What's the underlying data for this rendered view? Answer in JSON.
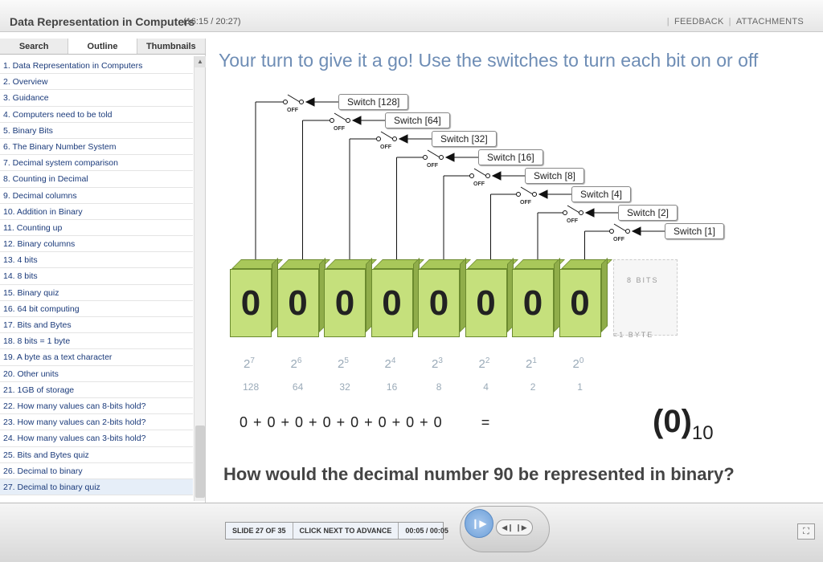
{
  "header": {
    "title": "Data Representation in Computers",
    "time": "(16:15 / 20:27)",
    "feedback": "FEEDBACK",
    "attachments": "ATTACHMENTS"
  },
  "sidebar": {
    "tabs": [
      "Search",
      "Outline",
      "Thumbnails"
    ],
    "items": [
      "1. Data Representation in Computers",
      "2. Overview",
      "3. Guidance",
      "4. Computers need to be told",
      "5. Binary Bits",
      "6. The Binary Number System",
      "7. Decimal system comparison",
      "8. Counting in Decimal",
      "9. Decimal columns",
      "10. Addition in Binary",
      "11. Counting up",
      "12. Binary columns",
      "13. 4 bits",
      "14. 8 bits",
      "15. Binary quiz",
      "16. 64 bit computing",
      "17. Bits and Bytes",
      "18. 8 bits = 1 byte",
      "19. A byte as a text character",
      "20. Other units",
      "21. 1GB of storage",
      "22. How many values can 8-bits hold?",
      "23. How many values can 2-bits hold?",
      "24. How many values can 3-bits hold?",
      "25. Bits and Bytes quiz",
      "26. Decimal to binary",
      "27. Decimal to binary quiz"
    ]
  },
  "main": {
    "heading": "Your turn to give it a go! Use the switches to turn each bit on or off",
    "switches": [
      "Switch [128]",
      "Switch [64]",
      "Switch [32]",
      "Switch [16]",
      "Switch [8]",
      "Switch [4]",
      "Switch [2]",
      "Switch [1]"
    ],
    "switch_state": "OFF",
    "bits": [
      "0",
      "0",
      "0",
      "0",
      "0",
      "0",
      "0",
      "0"
    ],
    "exponents": [
      "7",
      "6",
      "5",
      "4",
      "3",
      "2",
      "1",
      "0"
    ],
    "base": "2",
    "values": [
      "128",
      "64",
      "32",
      "16",
      "8",
      "4",
      "2",
      "1"
    ],
    "bits_note": "8 BITS",
    "byte_note": "=1 BYTE",
    "equation": "0 + 0 + 0 + 0 + 0 + 0 + 0 + 0",
    "equals": "=",
    "result": "(0)",
    "result_base": "10",
    "question": "How would the decimal number 90 be represented in binary?"
  },
  "footer": {
    "slide": "SLIDE 27 OF 35",
    "advance": "CLICK NEXT TO ADVANCE",
    "timer": "00:05 / 00:05"
  }
}
